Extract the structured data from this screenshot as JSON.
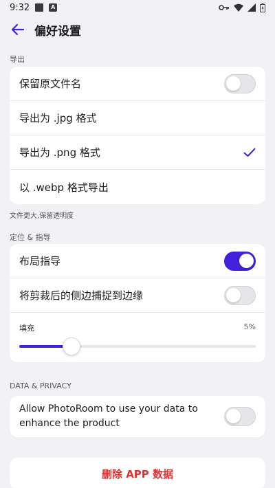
{
  "status": {
    "time": "9:32"
  },
  "header": {
    "title": "偏好设置"
  },
  "export": {
    "section_label": "导出",
    "items": [
      {
        "label": "保留原文件名",
        "type": "toggle",
        "on": false
      },
      {
        "label": "导出为 .jpg 格式",
        "type": "radio",
        "selected": false
      },
      {
        "label": "导出为 .png 格式",
        "type": "radio",
        "selected": true
      },
      {
        "label": "以 .webp 格式导出",
        "type": "radio",
        "selected": false
      }
    ],
    "footnote": "文件更大,保留透明度"
  },
  "guides": {
    "section_label": "定位 & 指导",
    "items": [
      {
        "label": "布局指导",
        "on": true
      },
      {
        "label": "将剪裁后的侧边捕捉到边缘",
        "on": false
      }
    ],
    "padding": {
      "label": "填充",
      "value_text": "5%",
      "value": 0.22
    }
  },
  "privacy": {
    "section_label": "DATA & PRIVACY",
    "label_line1": "Allow PhotoRoom to use your data to",
    "label_line2": "enhance the product",
    "on": false
  },
  "danger": {
    "delete_label": "删除 APP 数据"
  },
  "colors": {
    "accent": "#4320d9",
    "danger": "#e03131",
    "background": "#f2f2f6"
  }
}
